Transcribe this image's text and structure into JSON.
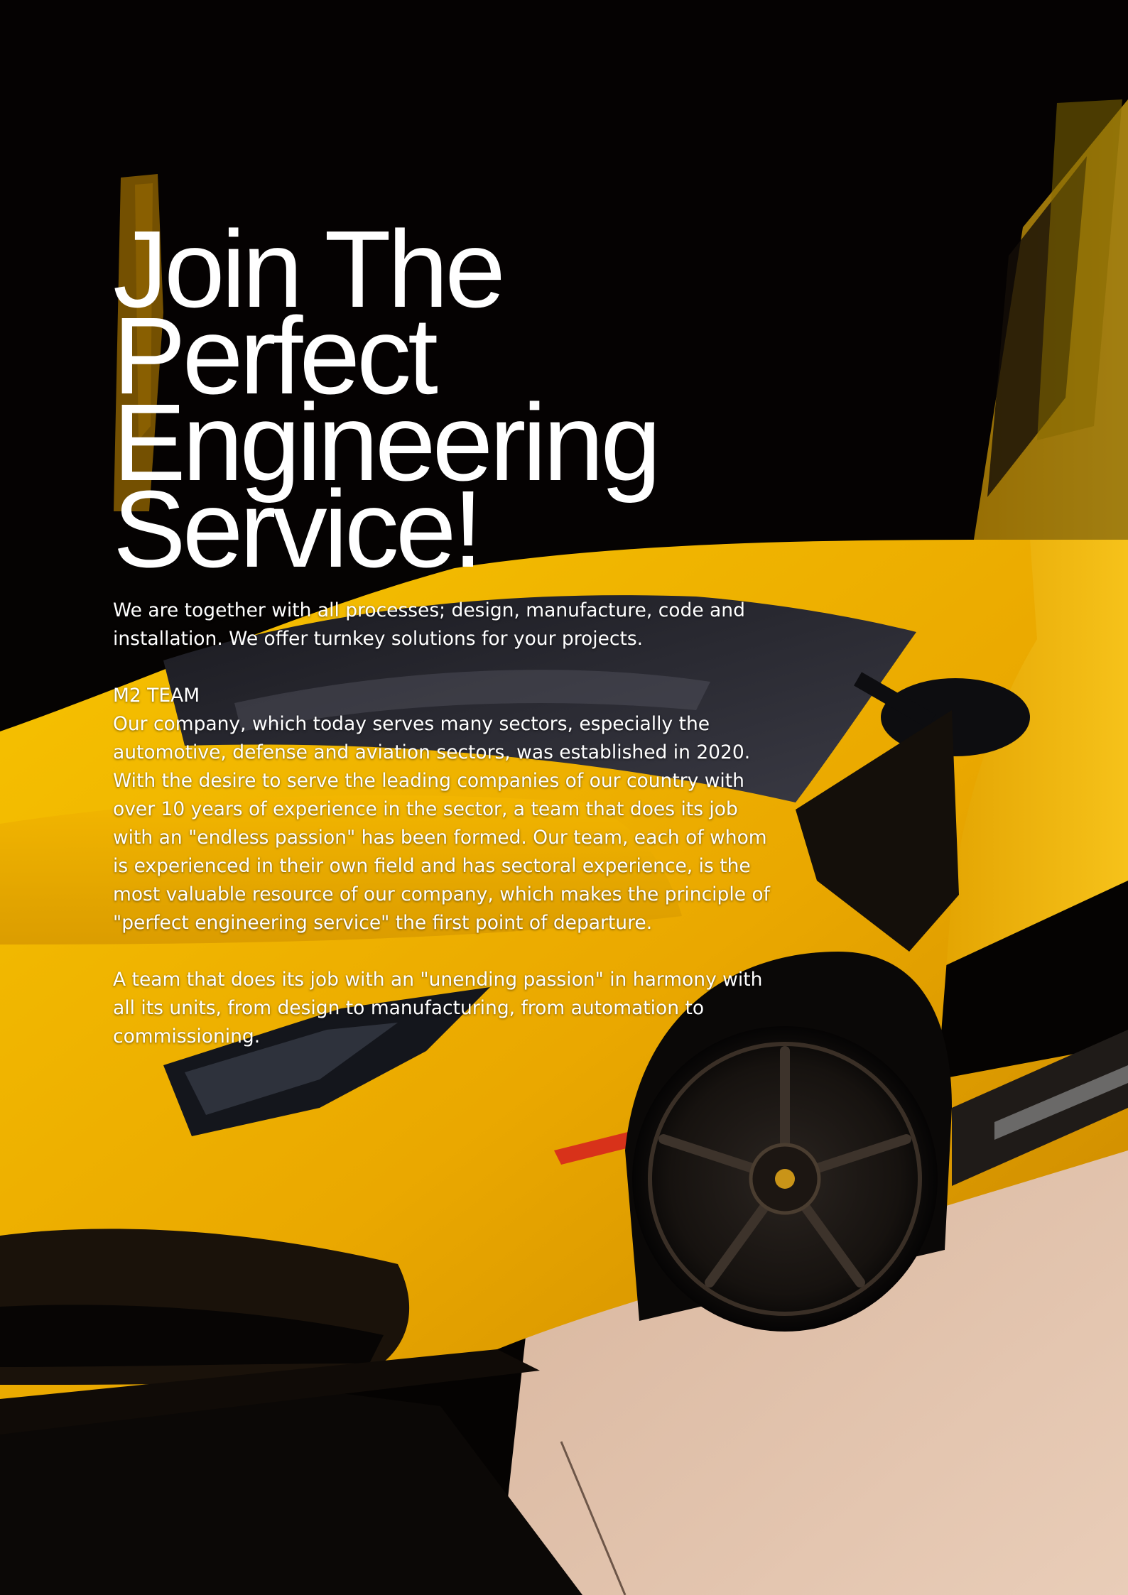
{
  "headline": {
    "line1": "Join The Perfect",
    "line2": "Engineering",
    "line3": "Service!"
  },
  "intro": "We are together with all processes; design, manufacture, code and installation. We offer turnkey solutions for your projects.",
  "team": {
    "heading": "M2 TEAM",
    "body": "Our company, which today serves many sectors, especially the automotive, defense and aviation sectors, was established in 2020. With the desire to serve the leading companies of our country with over 10 years of experience in the sector, a team that does its job with an \"endless passion\" has been formed. Our team, each of whom is experienced in their own field and has sectoral experience, is the most valuable resource of our company, which makes the principle of \"perfect engineering service\" the first point of departure."
  },
  "closing": "A team that does its job with an \"unending passion\" in harmony with all its units, from design to manufacturing, from automation to commissioning.",
  "colors": {
    "background": "#050302",
    "car_yellow": "#f0b400",
    "text": "#ffffff"
  }
}
